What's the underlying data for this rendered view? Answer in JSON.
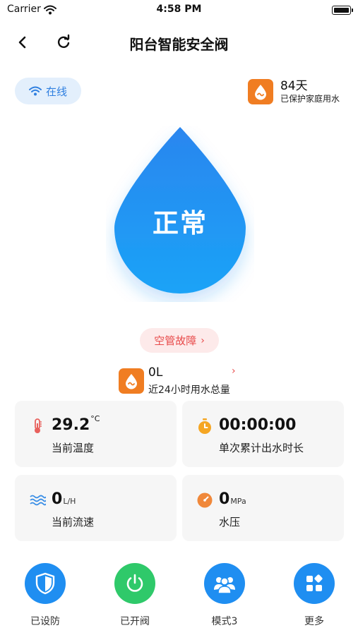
{
  "status_bar": {
    "carrier": "Carrier",
    "time": "4:58 PM"
  },
  "nav": {
    "title": "阳台智能安全阀"
  },
  "status": {
    "online_label": "在线"
  },
  "protection": {
    "days": "84天",
    "subtitle": "已保护家庭用水"
  },
  "drop": {
    "state": "正常"
  },
  "fault": {
    "label": "空管故障"
  },
  "usage": {
    "value": "0L",
    "label": "近24小时用水总量"
  },
  "metrics": {
    "temperature": {
      "value": "29.2",
      "unit": "°C",
      "label": "当前温度"
    },
    "duration": {
      "value": "00:00:00",
      "label": "单次累计出水时长"
    },
    "flow": {
      "value": "0",
      "unit": "L/H",
      "label": "当前流速"
    },
    "pressure": {
      "value": "0",
      "unit": "MPa",
      "label": "水压"
    }
  },
  "actions": [
    {
      "label": "已设防",
      "icon": "shield-icon"
    },
    {
      "label": "已开阀",
      "icon": "power-icon"
    },
    {
      "label": "模式3",
      "icon": "people-icon"
    },
    {
      "label": "更多",
      "icon": "grid-icon"
    }
  ],
  "colors": {
    "brand_blue": "#1f8ef1",
    "valve_green": "#2fc96a",
    "alert_red": "#e84a4a",
    "orange": "#f07d22",
    "online_bg": "#e3effc"
  }
}
